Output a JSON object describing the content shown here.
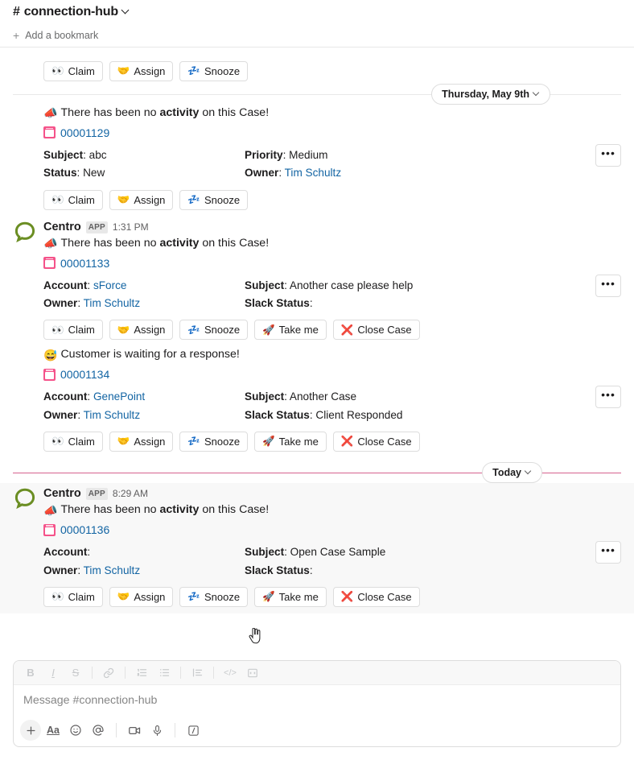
{
  "header": {
    "channel_name": "connection-hub",
    "hash": "#",
    "chevron_icon": "chevron-down-icon"
  },
  "bookmark_bar": {
    "add_label": "Add a bookmark",
    "plus_icon": "plus-icon"
  },
  "dividers": {
    "previous": "Thursday, May 9th",
    "today": "Today"
  },
  "action_labels": {
    "claim": "Claim",
    "assign": "Assign",
    "snooze": "Snooze",
    "take_me": "Take me",
    "close_case": "Close Case"
  },
  "action_icons": {
    "claim": "👀",
    "assign": "🤝",
    "snooze": "💤",
    "take_me": "🚀",
    "close_case": "❌"
  },
  "overflow_label": "•••",
  "labels": {
    "subject": "Subject",
    "status": "Status",
    "priority": "Priority",
    "owner": "Owner",
    "account": "Account",
    "slack_status": "Slack Status"
  },
  "messages": [
    {
      "id": "msg-partial-top",
      "partial": true,
      "sender": "",
      "app_tag": "",
      "time": "",
      "text_prefix": "There has been no ",
      "text_bold": "activity",
      "text_suffix": " on this Case!",
      "emoji": "📣",
      "actions": [
        "claim",
        "assign",
        "snooze"
      ]
    },
    {
      "id": "msg-00001129",
      "partial": false,
      "sender": "",
      "app_tag": "",
      "time": "",
      "text_prefix": "There has been no ",
      "text_bold": "activity",
      "text_suffix": " on this Case!",
      "emoji": "📣",
      "case_number": "00001129",
      "fields": [
        {
          "label": "Subject",
          "value": "abc",
          "link": false
        },
        {
          "label": "Priority",
          "value": "Medium",
          "link": false
        },
        {
          "label": "Status",
          "value": "New",
          "link": false
        },
        {
          "label": "Owner",
          "value": "Tim Schultz",
          "link": true
        }
      ],
      "actions": [
        "claim",
        "assign",
        "snooze"
      ]
    },
    {
      "id": "msg-00001133",
      "partial": false,
      "sender": "Centro",
      "app_tag": "APP",
      "time": "1:31 PM",
      "text_prefix": "There has been no ",
      "text_bold": "activity",
      "text_suffix": " on this Case!",
      "emoji": "📣",
      "case_number": "00001133",
      "fields": [
        {
          "label": "Account",
          "value": "sForce",
          "link": true
        },
        {
          "label": "Subject",
          "value": "Another case please help",
          "link": false
        },
        {
          "label": "Owner",
          "value": "Tim Schultz",
          "link": true
        },
        {
          "label": "Slack Status",
          "value": "",
          "link": false
        }
      ],
      "actions": [
        "claim",
        "assign",
        "snooze",
        "take_me",
        "close_case"
      ]
    },
    {
      "id": "msg-00001134",
      "partial": false,
      "sender": "",
      "app_tag": "",
      "time": "",
      "text_prefix": "Customer is waiting for a response!",
      "text_bold": "",
      "text_suffix": "",
      "emoji": "😅",
      "case_number": "00001134",
      "fields": [
        {
          "label": "Account",
          "value": "GenePoint",
          "link": true
        },
        {
          "label": "Subject",
          "value": "Another Case",
          "link": false
        },
        {
          "label": "Owner",
          "value": "Tim Schultz",
          "link": true
        },
        {
          "label": "Slack Status",
          "value": "Client Responded",
          "link": false
        }
      ],
      "actions": [
        "claim",
        "assign",
        "snooze",
        "take_me",
        "close_case"
      ]
    },
    {
      "id": "msg-00001136",
      "partial": false,
      "highlight": true,
      "sender": "Centro",
      "app_tag": "APP",
      "time": "8:29 AM",
      "text_prefix": "There has been no ",
      "text_bold": "activity",
      "text_suffix": " on this Case!",
      "emoji": "📣",
      "case_number": "00001136",
      "fields": [
        {
          "label": "Account",
          "value": "",
          "link": false
        },
        {
          "label": "Subject",
          "value": "Open Case Sample",
          "link": false
        },
        {
          "label": "Owner",
          "value": "Tim Schultz",
          "link": true
        },
        {
          "label": "Slack Status",
          "value": "",
          "link": false
        }
      ],
      "actions": [
        "claim",
        "assign",
        "snooze",
        "take_me",
        "close_case"
      ]
    }
  ],
  "composer": {
    "placeholder": "Message #connection-hub",
    "format_buttons": [
      {
        "name": "bold-icon",
        "glyph": "B"
      },
      {
        "name": "italic-icon",
        "glyph": "I"
      },
      {
        "name": "strikethrough-icon",
        "glyph": "S"
      },
      {
        "name": "link-icon",
        "glyph": "🔗"
      },
      {
        "name": "ordered-list-icon",
        "glyph": ""
      },
      {
        "name": "bulleted-list-icon",
        "glyph": ""
      },
      {
        "name": "blockquote-icon",
        "glyph": ""
      },
      {
        "name": "code-icon",
        "glyph": "</>"
      },
      {
        "name": "code-block-icon",
        "glyph": ""
      }
    ],
    "tool_buttons": [
      {
        "name": "plus-icon"
      },
      {
        "name": "text-format-icon"
      },
      {
        "name": "emoji-icon"
      },
      {
        "name": "mention-icon"
      },
      {
        "name": "video-icon"
      },
      {
        "name": "microphone-icon"
      },
      {
        "name": "slash-command-icon"
      }
    ]
  },
  "colors": {
    "link": "#1264a3",
    "case_icon": "#f5538a",
    "avatar_green": "#6b8e23",
    "today_divider": "#d5628f",
    "highlight_bg": "#f8f8f8"
  }
}
